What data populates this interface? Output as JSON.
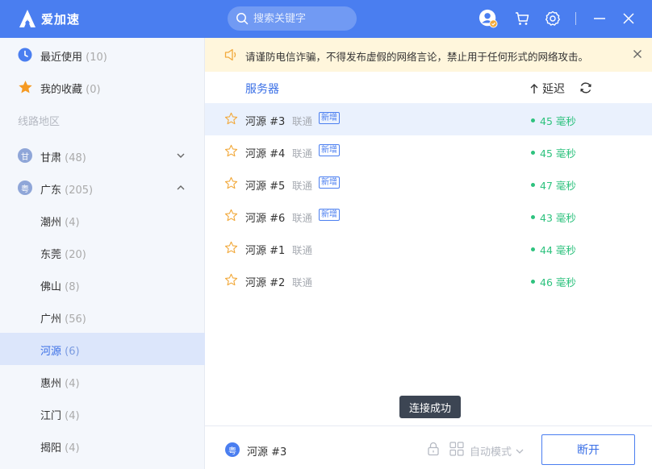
{
  "app": {
    "title": "爱加速",
    "accent": "#4a7ef0",
    "success": "#2ec27e"
  },
  "search": {
    "placeholder": "搜索关键字"
  },
  "header_icons": [
    "user-avatar-icon",
    "cart-icon",
    "gear-icon",
    "minimize-icon",
    "close-icon"
  ],
  "sidebar": {
    "recent": {
      "label": "最近使用",
      "count": "(10)"
    },
    "favorites": {
      "label": "我的收藏",
      "count": "(0)"
    },
    "section_title": "线路地区",
    "regions": [
      {
        "badge": "甘",
        "label": "甘肃",
        "count": "(48)",
        "expanded": false
      },
      {
        "badge": "粤",
        "label": "广东",
        "count": "(205)",
        "expanded": true
      }
    ],
    "cities": [
      {
        "label": "潮州",
        "count": "(4)"
      },
      {
        "label": "东莞",
        "count": "(20)"
      },
      {
        "label": "佛山",
        "count": "(8)"
      },
      {
        "label": "广州",
        "count": "(56)"
      },
      {
        "label": "河源",
        "count": "(6)",
        "active": true
      },
      {
        "label": "惠州",
        "count": "(4)"
      },
      {
        "label": "江门",
        "count": "(4)"
      },
      {
        "label": "揭阳",
        "count": "(4)"
      }
    ]
  },
  "notice": {
    "text": "请谨防电信诈骗，不得发布虚假的网络言论，禁止用于任何形式的网络攻击。"
  },
  "list": {
    "col_server": "服务器",
    "col_delay": "延迟",
    "rows": [
      {
        "name": "河源 #3",
        "isp": "联通",
        "tag": "新增",
        "latency": "45 毫秒",
        "selected": true
      },
      {
        "name": "河源 #4",
        "isp": "联通",
        "tag": "新增",
        "latency": "45 毫秒"
      },
      {
        "name": "河源 #5",
        "isp": "联通",
        "tag": "新增",
        "latency": "47 毫秒"
      },
      {
        "name": "河源 #6",
        "isp": "联通",
        "tag": "新增",
        "latency": "43 毫秒"
      },
      {
        "name": "河源 #1",
        "isp": "联通",
        "tag": "",
        "latency": "44 毫秒"
      },
      {
        "name": "河源 #2",
        "isp": "联通",
        "tag": "",
        "latency": "46 毫秒"
      }
    ]
  },
  "tooltip": "连接成功",
  "footer": {
    "badge": "粤",
    "current": "河源 #3",
    "mode": "自动模式",
    "disconnect": "断开"
  }
}
